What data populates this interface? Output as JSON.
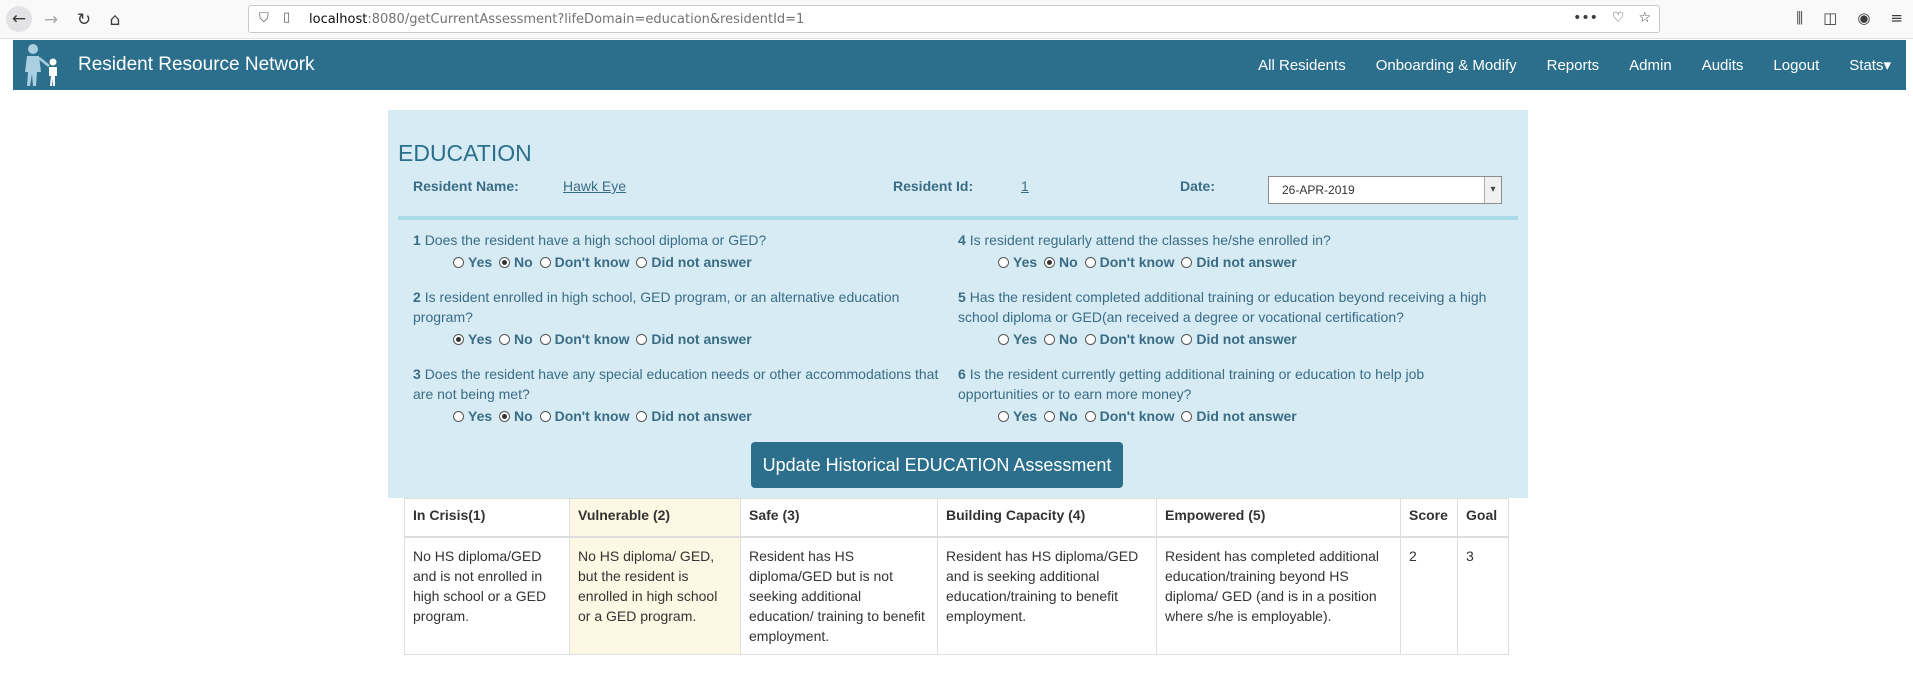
{
  "browser": {
    "url_host": "localhost",
    "url_rest": ":8080/getCurrentAssessment?lifeDomain=education&residentId=1"
  },
  "navbar": {
    "brand": "Resident Resource Network",
    "items": [
      "All Residents",
      "Onboarding & Modify",
      "Reports",
      "Admin",
      "Audits",
      "Logout",
      "Stats▾"
    ]
  },
  "assessment": {
    "title": "EDUCATION",
    "resident_name_label": "Resident Name:",
    "resident_name": "Hawk Eye",
    "resident_id_label": "Resident Id:",
    "resident_id": "1",
    "date_label": "Date:",
    "date_value": "26-APR-2019",
    "option_labels": [
      "Yes",
      "No",
      "Don't know",
      "Did not answer"
    ],
    "questions": [
      {
        "num": "1",
        "text": "Does the resident have a high school diploma or GED?",
        "selected": "No"
      },
      {
        "num": "2",
        "text": "Is resident enrolled in high school, GED program, or an alternative education program?",
        "selected": "Yes"
      },
      {
        "num": "3",
        "text": "Does the resident have any special education needs or other accommodations that are not being met?",
        "selected": "No"
      },
      {
        "num": "4",
        "text": "Is resident regularly attend the classes he/she enrolled in?",
        "selected": "No"
      },
      {
        "num": "5",
        "text": "Has the resident completed additional training or education beyond receiving a high school diploma or GED(an received a degree or vocational certification?",
        "selected": ""
      },
      {
        "num": "6",
        "text": "Is the resident currently getting additional training or education to help job opportunities or to earn more money?",
        "selected": ""
      }
    ],
    "update_button": "Update Historical EDUCATION Assessment"
  },
  "rubric": {
    "headers": [
      "In Crisis(1)",
      "Vulnerable (2)",
      "Safe (3)",
      "Building Capacity (4)",
      "Empowered (5)",
      "Score",
      "Goal"
    ],
    "cells": [
      "No HS diploma/GED and is not enrolled in high school or a GED program.",
      "No HS diploma/ GED, but the resident is enrolled in high school or a GED program.",
      "Resident has HS diploma/GED but is not seeking additional education/ training to benefit employment.",
      "Resident has HS diploma/GED and is seeking additional education/training to benefit employment.",
      "Resident has completed additional education/training beyond HS diploma/ GED (and is in a position where s/he is employable).",
      "2",
      "3"
    ],
    "highlight_color": "#fdf8e3"
  },
  "colors": {
    "navbar": "#2c6f8c",
    "panel": "#d7ebf4",
    "text_accent": "#3a6d85"
  }
}
